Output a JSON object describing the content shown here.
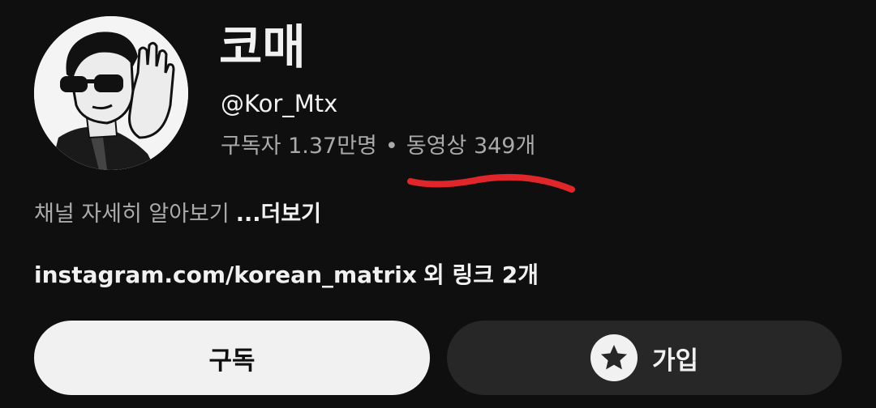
{
  "channel": {
    "name": "코매",
    "handle": "@Kor_Mtx",
    "subscribers": "구독자 1.37만명",
    "separator": "•",
    "videos": "동영상 349개"
  },
  "description": {
    "text": "채널 자세히 알아보기",
    "more_label": "...더보기"
  },
  "links": {
    "primary": "instagram.com/korean_matrix",
    "suffix": "외 링크 2개"
  },
  "buttons": {
    "subscribe_label": "구독",
    "join_label": "가입",
    "join_icon": "star-icon"
  },
  "annotation": {
    "underline_color": "#e0262b"
  },
  "colors": {
    "background": "#0f0f0f",
    "primary_text": "#f1f1f1",
    "secondary_text": "#aaaaaa",
    "subscribe_button_bg": "#f1f1f1",
    "join_button_bg": "#272727"
  }
}
